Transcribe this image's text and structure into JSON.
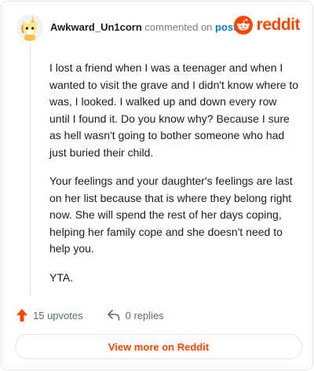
{
  "header": {
    "username": "Awkward_Un1corn",
    "action_text": "commented on",
    "post_link": "post",
    "brand": "reddit"
  },
  "avatar": {
    "icon": "unicorn-avatar-icon"
  },
  "comment": {
    "paragraphs": [
      "I lost a friend when I was a teenager and when I wanted to visit the grave and I didn't know where to was, I looked. I walked up and down every row until I found it. Do you know why? Because I sure as hell wasn't going to bother someone who had just buried their child.",
      "Your feelings and your daughter's feelings are last on her list because that is where they belong right now. She will spend the rest of her days coping, helping her family cope and she doesn't need to help you.",
      "YTA."
    ]
  },
  "footer": {
    "upvotes": "15 upvotes",
    "replies": "0 replies"
  },
  "view_more": "View more on Reddit",
  "colors": {
    "brand": "#ff4500",
    "link": "#0079d3",
    "muted": "#576f76"
  }
}
